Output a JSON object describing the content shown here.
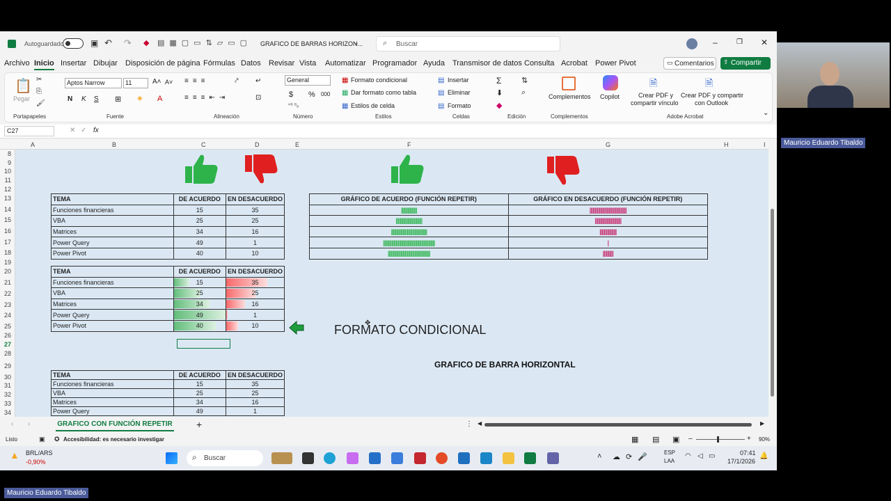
{
  "window": {
    "autosave": "Autoguardado",
    "doc_title": "GRAFICO DE BARRAS HORIZON...",
    "search_placeholder": "Buscar"
  },
  "menu": [
    "Archivo",
    "Inicio",
    "Insertar",
    "Dibujar",
    "Disposición de página",
    "Fórmulas",
    "Datos",
    "Revisar",
    "Vista",
    "Automatizar",
    "Programador",
    "Ayuda",
    "Transmisor de datos",
    "Consulta",
    "Acrobat",
    "Power Pivot"
  ],
  "menu_right": {
    "comments": "Comentarios",
    "share": "Compartir"
  },
  "ribbon": {
    "paste": "Pegar",
    "clipboard": "Portapapeles",
    "font_name": "Aptos Narrow",
    "font_size": "11",
    "font_group": "Fuente",
    "align_group": "Alineación",
    "number_format": "General",
    "number_group": "Número",
    "cond_format": "Formato condicional",
    "table_format": "Dar formato como tabla",
    "cell_styles": "Estilos de celda",
    "styles_group": "Estilos",
    "insert": "Insertar",
    "delete": "Eliminar",
    "format": "Formato",
    "cells_group": "Celdas",
    "edit_group": "Edición",
    "addins": "Complementos",
    "addins_group": "Complementos",
    "copilot": "Copilot",
    "pdf_link_1": "Crear PDF y",
    "pdf_link_2": "compartir vínculo",
    "pdf_outlook_1": "Crear PDF y compartir",
    "pdf_outlook_2": "con Outlook",
    "acrobat_group": "Adobe Acrobat"
  },
  "formula_bar": {
    "name_box": "C27",
    "fx": "fx",
    "content": ""
  },
  "columns": [
    "A",
    "B",
    "C",
    "D",
    "E",
    "F",
    "G",
    "H",
    "I"
  ],
  "rows": [
    "8",
    "9",
    "10",
    "11",
    "12",
    "13",
    "14",
    "15",
    "16",
    "17",
    "18",
    "19",
    "20",
    "21",
    "22",
    "23",
    "24",
    "25",
    "26",
    "27",
    "28",
    "29",
    "30",
    "31",
    "32",
    "33",
    "34"
  ],
  "headers": {
    "tema": "TEMA",
    "acuerdo": "DE ACUERDO",
    "desacuerdo": "EN DESACUERDO"
  },
  "table_rows": [
    {
      "tema": "Funciones financieras",
      "acuerdo": "15",
      "desacuerdo": "35",
      "a": 15,
      "d": 35
    },
    {
      "tema": "VBA",
      "acuerdo": "25",
      "desacuerdo": "25",
      "a": 25,
      "d": 25
    },
    {
      "tema": "Matrices",
      "acuerdo": "34",
      "desacuerdo": "16",
      "a": 34,
      "d": 16
    },
    {
      "tema": "Power Query",
      "acuerdo": "49",
      "desacuerdo": "1",
      "a": 49,
      "d": 1
    },
    {
      "tema": "Power Pivot",
      "acuerdo": "40",
      "desacuerdo": "10",
      "a": 40,
      "d": 10
    }
  ],
  "bottom_rows": [
    {
      "tema": "Funciones financieras",
      "acuerdo": "15",
      "desacuerdo": "35"
    },
    {
      "tema": "VBA",
      "acuerdo": "25",
      "desacuerdo": "25"
    },
    {
      "tema": "Matrices",
      "acuerdo": "34",
      "desacuerdo": "16"
    },
    {
      "tema": "Power Query",
      "acuerdo": "49",
      "desacuerdo": "1"
    }
  ],
  "repeat_chart": {
    "left_title": "GRÁFICO  DE ACUERDO (FUNCIÓN REPETIR)",
    "right_title": "GRÁFICO EN DESACUERDO (FUNCIÓN REPETIR)",
    "agree": [
      15,
      25,
      34,
      49,
      40
    ],
    "disagree": [
      35,
      25,
      16,
      1,
      10
    ],
    "green": "#3cb85c",
    "pink": "#c8407c"
  },
  "labels": {
    "cond_format": "FORMATO CONDICIONAL",
    "bar_chart": "GRAFICO DE BARRA HORIZONTAL"
  },
  "sheet_tab": "GRAFICO CON FUNCIÓN REPETIR",
  "status": {
    "ready": "Listo",
    "accessibility": "Accesibilidad: es necesario investigar",
    "zoom": "90%"
  },
  "taskbar": {
    "ticker": "BRL/ARS",
    "ticker_change": "-0,90%",
    "search": "Buscar",
    "lang1": "ESP",
    "lang2": "LAA",
    "time": "07:41",
    "date": "17/1/2026"
  },
  "participant": "Mauricio Eduardo Tibaldo",
  "colors": {
    "green_thumb": "#2db34a",
    "red_thumb": "#e02020",
    "grid_bg": "#dbe8f4",
    "accent": "#107c41"
  }
}
